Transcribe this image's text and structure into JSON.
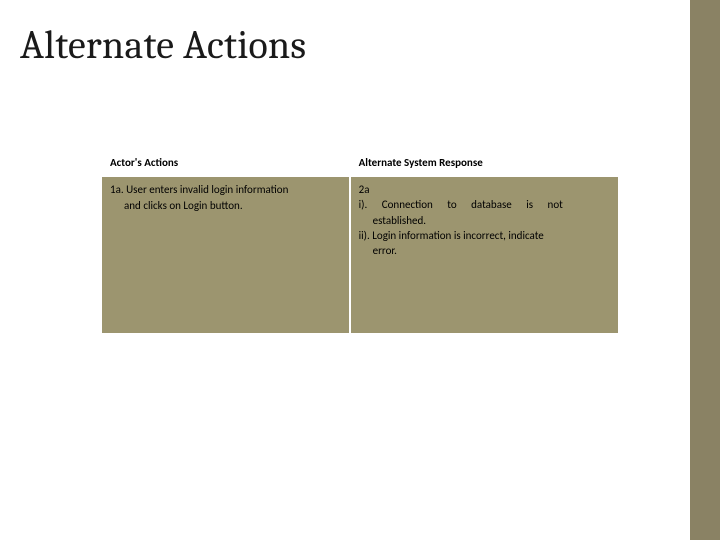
{
  "title": "Alternate Actions",
  "table": {
    "headers": [
      "Actor's Actions",
      "Alternate System Response"
    ],
    "row": {
      "left": {
        "line1": "1a. User enters invalid login information",
        "line2": "and clicks on Login button."
      },
      "right": {
        "line1": "2a",
        "line2": "i). Connection to database is not",
        "line3": "established.",
        "line4": "ii). Login information is incorrect, indicate",
        "line5": "error."
      }
    }
  }
}
